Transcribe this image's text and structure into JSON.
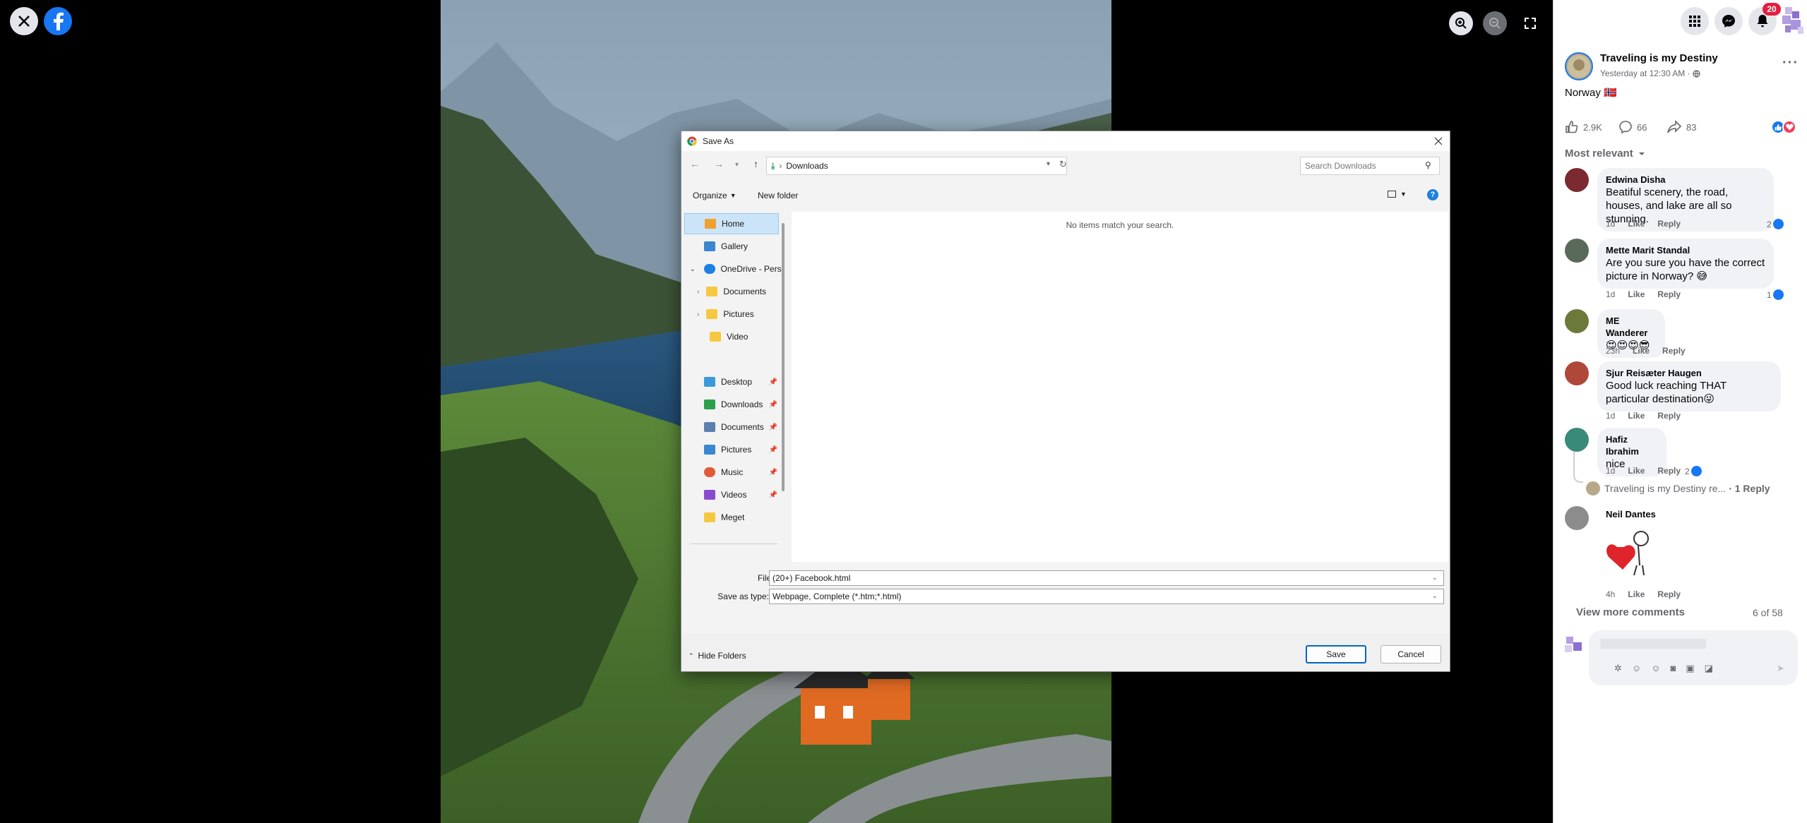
{
  "viewer": {
    "close_icon": "close-icon",
    "logo_icon": "facebook-logo",
    "zoom_in_icon": "zoom-in-icon",
    "zoom_out_icon": "zoom-out-icon",
    "fullscreen_icon": "fullscreen-icon"
  },
  "header": {
    "notification_count": "20"
  },
  "post": {
    "page_name": "Traveling is my Destiny",
    "timestamp": "Yesterday at 12:30 AM · ",
    "caption": "Norway 🇳🇴",
    "likes": "2.9K",
    "comments": "66",
    "shares": "83",
    "sort_label": "Most relevant"
  },
  "comments": [
    {
      "name": "Edwina Disha",
      "text": "Beatiful scenery, the road, houses, and lake are all so stunning.",
      "time": "1d",
      "like": "Like",
      "reply": "Reply",
      "reactions": "2"
    },
    {
      "name": "Mette Marit Standal",
      "text": "Are you sure you have the correct picture in Norway? 😅",
      "time": "1d",
      "like": "Like",
      "reply": "Reply",
      "reactions": "1"
    },
    {
      "name": "ME Wanderer",
      "text": "😍😍😍😎",
      "time": "23h",
      "like": "Like",
      "reply": "Reply"
    },
    {
      "name": "Sjur Reisæter Haugen",
      "text": "Good luck reaching THAT particular destination😜",
      "time": "1d",
      "like": "Like",
      "reply": "Reply"
    },
    {
      "name": "Hafiz Ibrahim",
      "text": "nice",
      "time": "1d",
      "like": "Like",
      "reply": "Reply",
      "reactions": "2"
    },
    {
      "name": "Neil Dantes",
      "text": "",
      "time": "4h",
      "like": "Like",
      "reply": "Reply"
    }
  ],
  "reply_thread": {
    "text": "Traveling is my Destiny re...",
    "count": "· 1 Reply"
  },
  "view_more": "View more comments",
  "pager": "6 of 58",
  "dialog": {
    "title": "Save As",
    "path": "Downloads",
    "search_placeholder": "Search Downloads",
    "organize": "Organize",
    "new_folder": "New folder",
    "empty_message": "No items match your search.",
    "sidebar": [
      {
        "label": "Home",
        "icon": "home-icon",
        "color": "#f0a030"
      },
      {
        "label": "Gallery",
        "icon": "gallery-icon",
        "color": "#3a86d0"
      },
      {
        "label": "OneDrive - Pers",
        "icon": "cloud-icon",
        "color": "#1e80e0"
      },
      {
        "label": "Documents",
        "icon": "folder-icon",
        "color": "#f5c842"
      },
      {
        "label": "Pictures",
        "icon": "folder-icon",
        "color": "#f5c842"
      },
      {
        "label": "Video",
        "icon": "folder-icon",
        "color": "#f5c842"
      },
      {
        "label": "Desktop",
        "icon": "desktop-icon",
        "color": "#3a9ad9"
      },
      {
        "label": "Downloads",
        "icon": "download-icon",
        "color": "#2aa04a"
      },
      {
        "label": "Documents",
        "icon": "documents-icon",
        "color": "#5a7fb0"
      },
      {
        "label": "Pictures",
        "icon": "pictures-icon",
        "color": "#3a86d0"
      },
      {
        "label": "Music",
        "icon": "music-icon",
        "color": "#e05a3a"
      },
      {
        "label": "Videos",
        "icon": "videos-icon",
        "color": "#8a4ad0"
      },
      {
        "label": "Meget",
        "icon": "folder-icon",
        "color": "#f5c842"
      }
    ],
    "file_name_label": "File name:",
    "file_name_value": "(20+) Facebook.html",
    "save_type_label": "Save as type:",
    "save_type_value": "Webpage, Complete (*.htm;*.html)",
    "hide_folders": "Hide Folders",
    "save_button": "Save",
    "cancel_button": "Cancel"
  }
}
